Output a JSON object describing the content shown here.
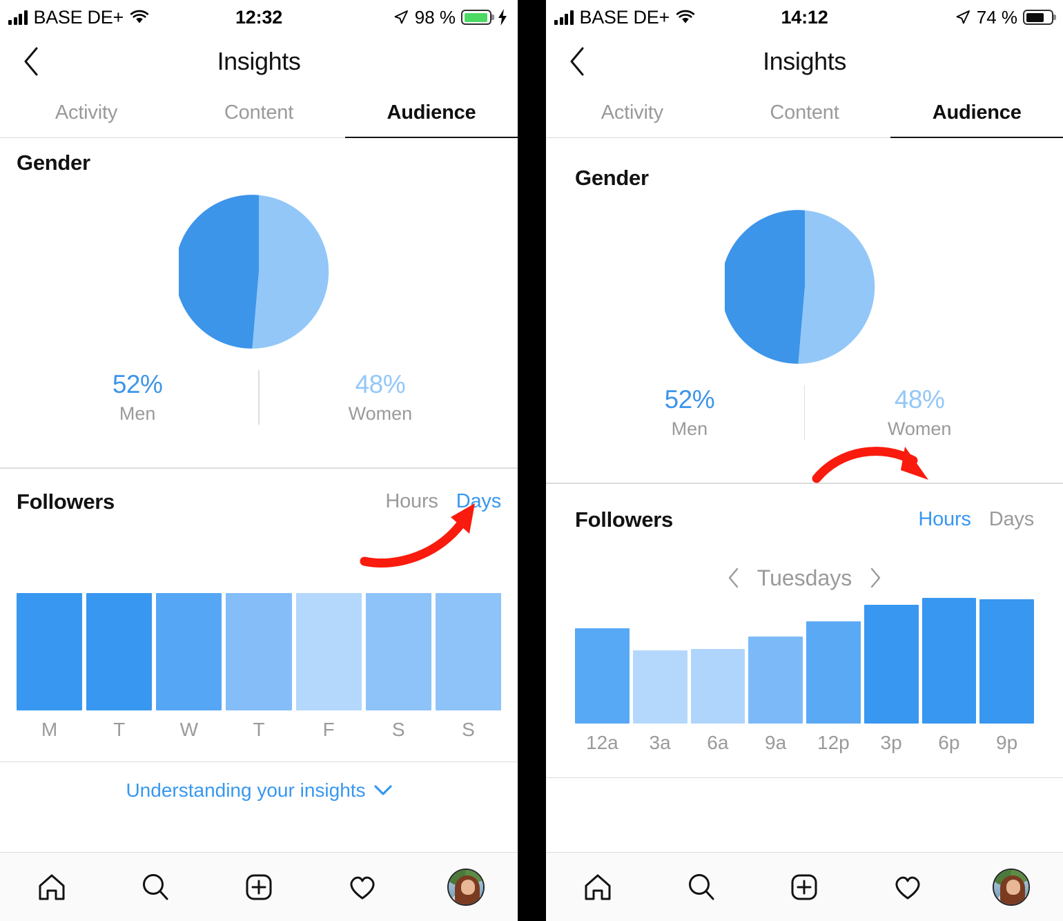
{
  "panels": [
    {
      "id": "left",
      "status": {
        "carrier": "BASE DE+",
        "time": "12:32",
        "battery_pct": "98 %",
        "battery_level": 95,
        "battery_color": "#4cd964",
        "charging": true,
        "wifi": "wifi-icon",
        "location": "location-arrow-icon"
      },
      "nav": {
        "back": "back-chevron-icon",
        "title": "Insights"
      },
      "tabs": [
        {
          "label": "Activity",
          "active": false
        },
        {
          "label": "Content",
          "active": false
        },
        {
          "label": "Audience",
          "active": true
        }
      ],
      "gender": {
        "title": "Gender",
        "men_value": "52%",
        "men_label": "Men",
        "women_value": "48%",
        "women_label": "Women",
        "men_color": "#3d95ea",
        "women_color": "#93c7f7"
      },
      "followers": {
        "title": "Followers",
        "toggle": [
          {
            "label": "Hours",
            "active": false
          },
          {
            "label": "Days",
            "active": true
          }
        ]
      },
      "footer_link": {
        "label": "Understanding your insights",
        "chevron": "chevron-down-icon"
      },
      "tabbar": [
        "home-icon",
        "search-icon",
        "add-post-icon",
        "heart-icon",
        "profile-avatar"
      ],
      "annotation": {
        "type": "red-curved-arrow",
        "points_to": "Days",
        "color": "#f91b0d"
      }
    },
    {
      "id": "right",
      "status": {
        "carrier": "BASE DE+",
        "time": "14:12",
        "battery_pct": "74 %",
        "battery_level": 74,
        "battery_color": "#0d0d0d",
        "charging": false,
        "wifi": "wifi-icon",
        "location": "location-arrow-icon"
      },
      "nav": {
        "back": "back-chevron-icon",
        "title": "Insights"
      },
      "tabs": [
        {
          "label": "Activity",
          "active": false
        },
        {
          "label": "Content",
          "active": false
        },
        {
          "label": "Audience",
          "active": true
        }
      ],
      "gender": {
        "title": "Gender",
        "men_value": "52%",
        "men_label": "Men",
        "women_value": "48%",
        "women_label": "Women",
        "men_color": "#3d95ea",
        "women_color": "#93c7f7"
      },
      "followers": {
        "title": "Followers",
        "toggle": [
          {
            "label": "Hours",
            "active": true
          },
          {
            "label": "Days",
            "active": false
          }
        ],
        "day_selector": {
          "prev": "chevron-left-icon",
          "value": "Tuesdays",
          "next": "chevron-right-icon"
        }
      },
      "tabbar": [
        "home-icon",
        "search-icon",
        "add-post-icon",
        "heart-icon",
        "profile-avatar"
      ],
      "annotation": {
        "type": "red-curved-arrow",
        "points_to": "Hours",
        "color": "#f91b0d"
      }
    }
  ],
  "chart_data": [
    {
      "type": "pie",
      "id": "gender-pie-left",
      "title": "Gender",
      "categories": [
        "Men",
        "Women"
      ],
      "values": [
        52,
        48
      ],
      "colors": [
        "#3d95ea",
        "#93c7f7"
      ],
      "legend": "below"
    },
    {
      "type": "bar",
      "id": "followers-days-left",
      "title": "Followers",
      "xlabel": "",
      "ylabel": "",
      "categories": [
        "M",
        "T",
        "W",
        "T",
        "F",
        "S",
        "S"
      ],
      "values": [
        100,
        100,
        100,
        100,
        100,
        100,
        100
      ],
      "ylim": [
        0,
        100
      ],
      "grid": false,
      "bar_colors": [
        "#3897f0",
        "#3897f0",
        "#55a6f5",
        "#84bdf8",
        "#b4d8fc",
        "#8dc3f9",
        "#8dc3f9"
      ],
      "note": "All day bars are equal height; relative intensity encoded by color shade"
    },
    {
      "type": "pie",
      "id": "gender-pie-right",
      "title": "Gender",
      "categories": [
        "Men",
        "Women"
      ],
      "values": [
        52,
        48
      ],
      "colors": [
        "#3d95ea",
        "#93c7f7"
      ],
      "legend": "below"
    },
    {
      "type": "bar",
      "id": "followers-hours-right",
      "title": "Followers",
      "subtitle": "Tuesdays",
      "xlabel": "",
      "ylabel": "",
      "categories": [
        "12a",
        "3a",
        "6a",
        "9a",
        "12p",
        "3p",
        "6p",
        "9p"
      ],
      "values": [
        69,
        53,
        54,
        63,
        74,
        86,
        91,
        90
      ],
      "ylim": [
        0,
        100
      ],
      "grid": false,
      "bar_colors": [
        "#57a8f5",
        "#b4d8fc",
        "#afd5fc",
        "#7cb9f8",
        "#5aa9f5",
        "#3897f0",
        "#3897f0",
        "#3897f0"
      ]
    }
  ]
}
